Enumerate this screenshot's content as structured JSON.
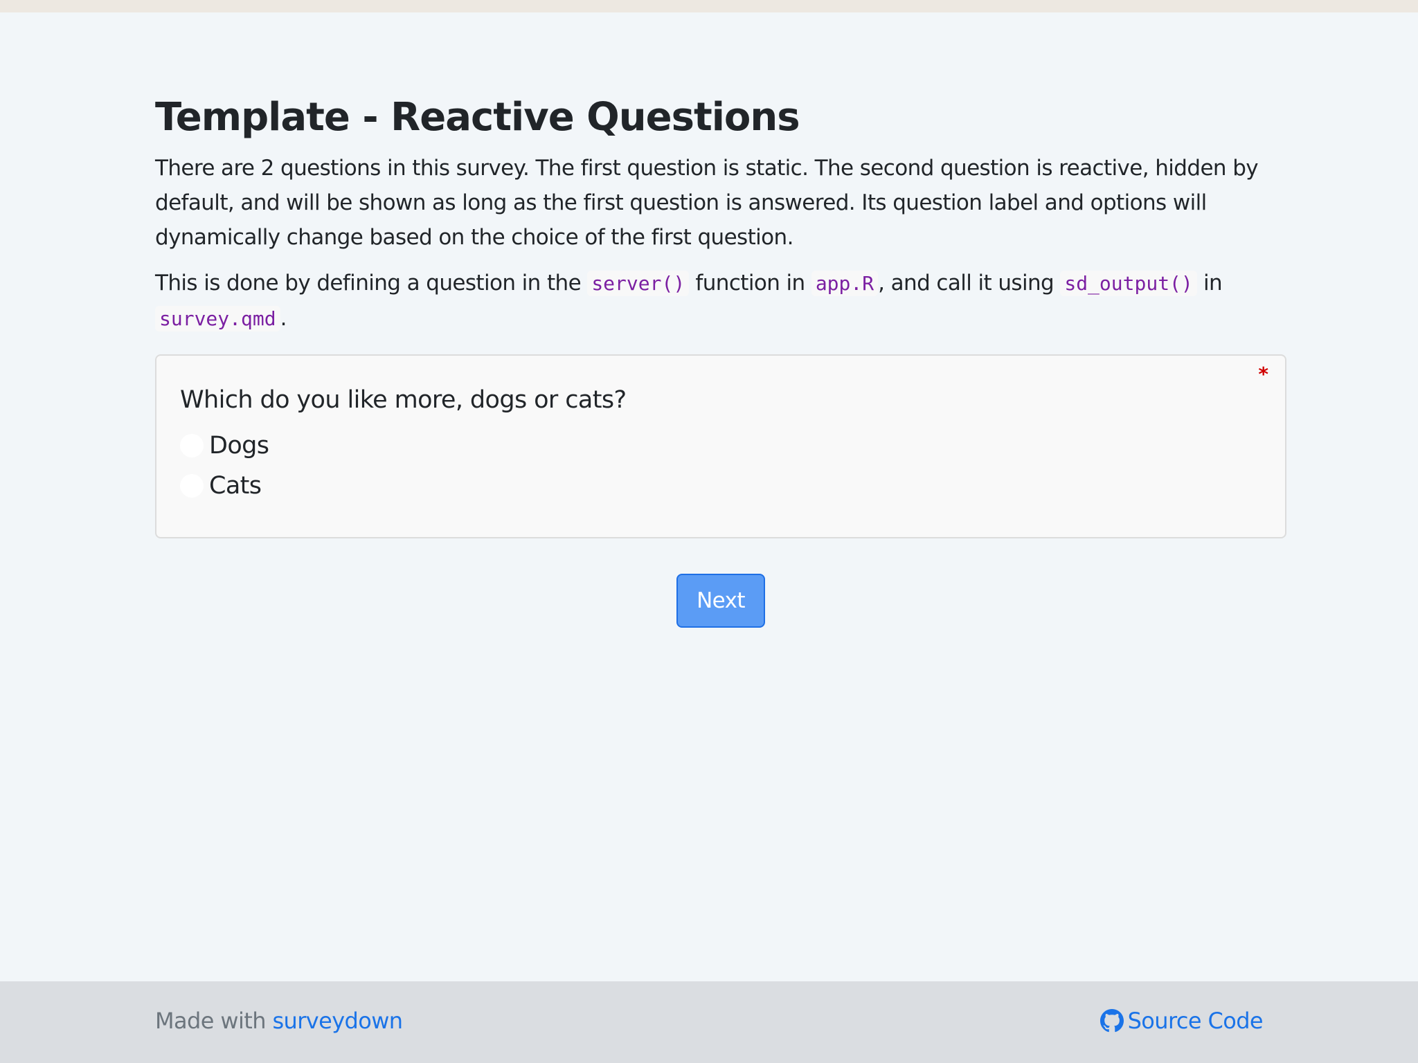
{
  "survey": {
    "title": "Template - Reactive Questions",
    "intro": "There are 2 questions in this survey. The first question is static. The second question is reactive, hidden by default, and will be shown as long as the first question is answered. Its question label and options will dynamically change based on the choice of the first question.",
    "second_paragraph": {
      "part1": "This is done by defining a question in the ",
      "code1": "server()",
      "part2": " function in ",
      "code2": "app.R",
      "part3": ", and call it using ",
      "code3": "sd_output()",
      "part4": " in ",
      "code4": "survey.qmd",
      "part5": "."
    }
  },
  "question": {
    "label": "Which do you like more, dogs or cats?",
    "required_marker": "*",
    "options": [
      {
        "label": "Dogs",
        "selected": false
      },
      {
        "label": "Cats",
        "selected": false
      }
    ]
  },
  "buttons": {
    "next_label": "Next"
  },
  "footer": {
    "made_with_text": "Made with ",
    "made_with_link": "surveydown",
    "source_code_label": "Source Code",
    "source_code_icon": "github-icon"
  },
  "colors": {
    "accent": "#1a73e8",
    "button_bg": "#5b9cf5",
    "code_text": "#7b1fa2",
    "required": "#d00000"
  }
}
